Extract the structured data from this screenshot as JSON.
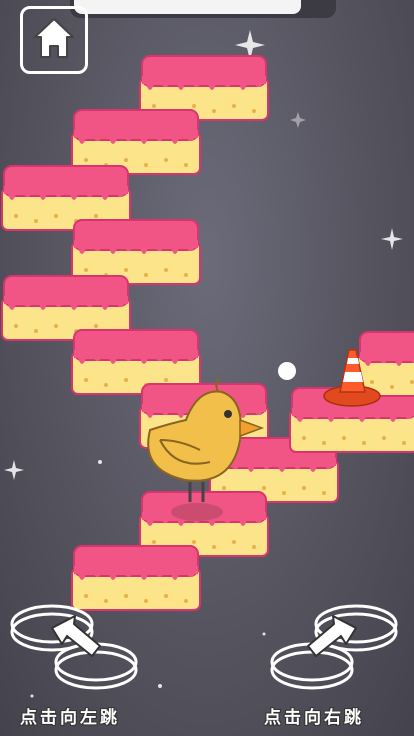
{
  "game": {
    "progress": 0.88,
    "home_button": {
      "icon": "home-icon"
    },
    "controls": {
      "left_hint": "点击向左跳",
      "right_hint": "点击向右跳",
      "left_icon": "jump-left-arrow-icon",
      "right_icon": "jump-right-arrow-icon"
    },
    "character": "yellow-chick",
    "obstacle": "traffic-cone-icon"
  },
  "colors": {
    "background": "#55545f",
    "frosting": "#f05586",
    "frosting_edge": "#d8346d",
    "cake": "#fbe48a",
    "sprinkle": "#e6b04a",
    "chick": "#f2c04a",
    "cone": "#ff5b2a"
  }
}
